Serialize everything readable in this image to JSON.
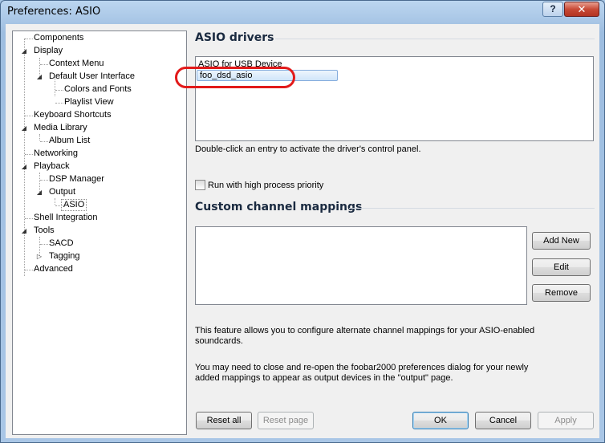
{
  "window": {
    "title": "Preferences: ASIO",
    "help_glyph": "?",
    "close_glyph": "✕"
  },
  "tree": {
    "items": [
      {
        "label": "Components"
      },
      {
        "label": "Display",
        "expanded": true
      },
      {
        "label": "Context Menu"
      },
      {
        "label": "Default User Interface",
        "expanded": true
      },
      {
        "label": "Colors and Fonts"
      },
      {
        "label": "Playlist View"
      },
      {
        "label": "Keyboard Shortcuts"
      },
      {
        "label": "Media Library",
        "expanded": true
      },
      {
        "label": "Album List"
      },
      {
        "label": "Networking"
      },
      {
        "label": "Playback",
        "expanded": true
      },
      {
        "label": "DSP Manager"
      },
      {
        "label": "Output",
        "expanded": true
      },
      {
        "label": "ASIO",
        "selected": true
      },
      {
        "label": "Shell Integration"
      },
      {
        "label": "Tools",
        "expanded": true
      },
      {
        "label": "SACD"
      },
      {
        "label": "Tagging",
        "expanded": false
      },
      {
        "label": "Advanced"
      }
    ]
  },
  "asio": {
    "heading": "ASIO drivers",
    "drivers": [
      "ASIO for USB Device",
      "foo_dsd_asio"
    ],
    "selected_driver": "foo_dsd_asio",
    "hint": "Double-click an entry to activate the driver's control panel.",
    "high_priority_label": "Run with high process priority",
    "high_priority_checked": false
  },
  "mappings": {
    "heading": "Custom channel mappings",
    "add_label": "Add New",
    "edit_label": "Edit",
    "remove_label": "Remove",
    "info1_line1": "This feature allows you to configure alternate channel mappings for your ASIO-enabled",
    "info1_line2": "soundcards.",
    "info2_line1": "You may need to close and re-open the foobar2000 preferences dialog for your newly",
    "info2_line2": "added mappings to appear as output devices in the \"output\" page."
  },
  "footer": {
    "reset_all": "Reset all",
    "reset_page": "Reset page",
    "ok": "OK",
    "cancel": "Cancel",
    "apply": "Apply"
  },
  "colors": {
    "highlight_ring": "#e21a1a",
    "section_title": "#1a2a40"
  }
}
